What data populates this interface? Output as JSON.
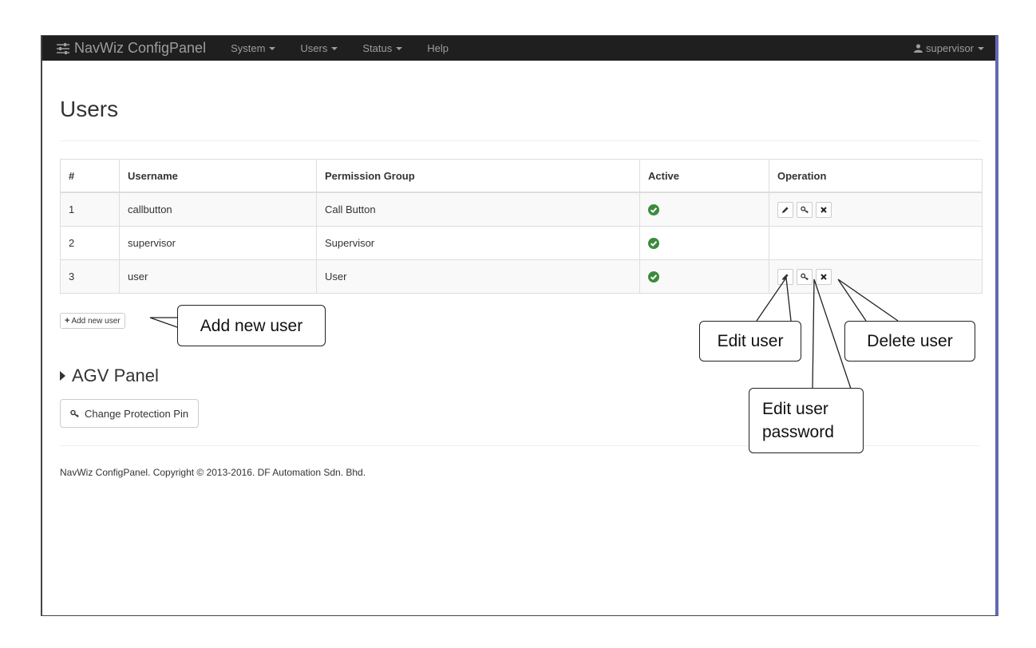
{
  "navbar": {
    "brand": "NavWiz ConfigPanel",
    "menus": [
      "System",
      "Users",
      "Status",
      "Help"
    ],
    "user": "supervisor"
  },
  "page": {
    "title": "Users"
  },
  "table": {
    "headers": [
      "#",
      "Username",
      "Permission Group",
      "Active",
      "Operation"
    ],
    "rows": [
      {
        "num": "1",
        "username": "callbutton",
        "group": "Call Button",
        "active": true,
        "operations": true
      },
      {
        "num": "2",
        "username": "supervisor",
        "group": "Supervisor",
        "active": true,
        "operations": false
      },
      {
        "num": "3",
        "username": "user",
        "group": "User",
        "active": true,
        "operations": true
      }
    ]
  },
  "buttons": {
    "add_user": "Add new user",
    "change_pin": "Change Protection Pin"
  },
  "agv_panel": {
    "title": "AGV Panel"
  },
  "footer": {
    "text": "NavWiz ConfigPanel. Copyright © 2013-2016. DF Automation Sdn. Bhd."
  },
  "callouts": {
    "add_user": "Add new user",
    "edit_user": "Edit user",
    "delete_user": "Delete user",
    "edit_password_line1": "Edit user",
    "edit_password_line2": "password"
  },
  "colors": {
    "navbar_bg": "#1f1f1f",
    "active_green": "#3c8b3c",
    "frame_right_border": "#6468b4"
  },
  "icons": {
    "brand": "sliders-icon",
    "user": "user-icon",
    "active": "check-circle-icon",
    "edit": "pencil-icon",
    "password": "key-icon",
    "delete": "x-icon",
    "expand": "triangle-right-icon"
  }
}
